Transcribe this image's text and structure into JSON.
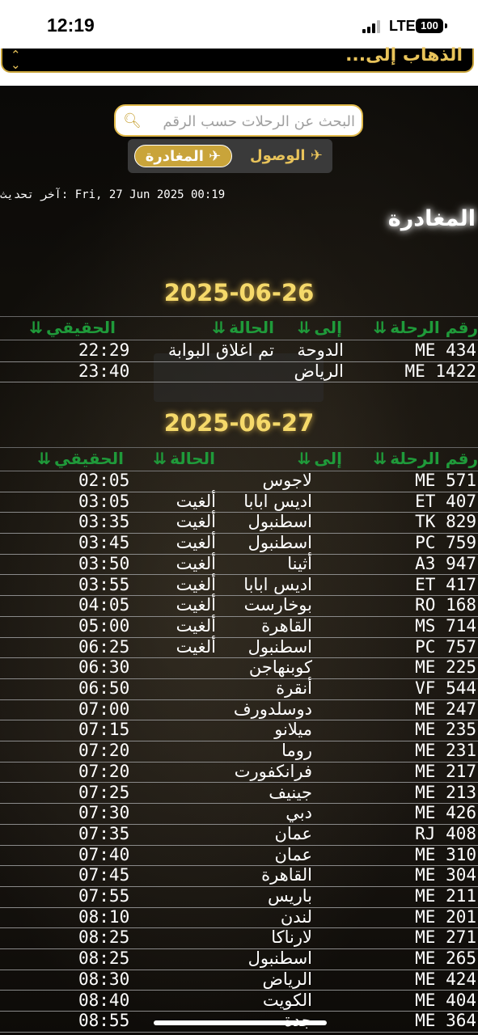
{
  "status_bar": {
    "time": "12:19",
    "network": "LTE",
    "battery": "100"
  },
  "destination_dropdown": {
    "label": "الذهاب إلى..."
  },
  "search": {
    "placeholder": "البحث عن الرحلات حسب الرقم"
  },
  "tabs": {
    "arrivals": "الوصول",
    "departures": "المغادرة",
    "active": "departures"
  },
  "last_updated": "آخر تحديث: Fri, 27 Jun 2025 00:19",
  "section_title": "المغادرة",
  "columns": {
    "flight": "رقم الرحلة",
    "to": "إلى",
    "status": "الحالة",
    "actual": "الحقيقي"
  },
  "groups": [
    {
      "date": "2025-06-26",
      "rows": [
        {
          "flight": "ME 434",
          "to": "الدوحة",
          "status": "تم اغلاق البوابة",
          "actual": "22:29"
        },
        {
          "flight": "ME 1422",
          "to": "الرياض",
          "status": "",
          "actual": "23:40"
        }
      ]
    },
    {
      "date": "2025-06-27",
      "rows": [
        {
          "flight": "ME 571",
          "to": "لاجوس",
          "status": "",
          "actual": "02:05"
        },
        {
          "flight": "ET 407",
          "to": "اديس ابابا",
          "status": "ألغيت",
          "actual": "03:05"
        },
        {
          "flight": "TK 829",
          "to": "اسطنبول",
          "status": "ألغيت",
          "actual": "03:35"
        },
        {
          "flight": "PC 759",
          "to": "اسطنبول",
          "status": "ألغيت",
          "actual": "03:45"
        },
        {
          "flight": "A3 947",
          "to": "أثينا",
          "status": "ألغيت",
          "actual": "03:50"
        },
        {
          "flight": "ET 417",
          "to": "اديس ابابا",
          "status": "ألغيت",
          "actual": "03:55"
        },
        {
          "flight": "RO 168",
          "to": "بوخارست",
          "status": "ألغيت",
          "actual": "04:05"
        },
        {
          "flight": "MS 714",
          "to": "القاهرة",
          "status": "ألغيت",
          "actual": "05:00"
        },
        {
          "flight": "PC 757",
          "to": "اسطنبول",
          "status": "ألغيت",
          "actual": "06:25"
        },
        {
          "flight": "ME 225",
          "to": "كوبنهاجن",
          "status": "",
          "actual": "06:30"
        },
        {
          "flight": "VF 544",
          "to": "أنقرة",
          "status": "",
          "actual": "06:50"
        },
        {
          "flight": "ME 247",
          "to": "دوسلدورف",
          "status": "",
          "actual": "07:00"
        },
        {
          "flight": "ME 235",
          "to": "ميلانو",
          "status": "",
          "actual": "07:15"
        },
        {
          "flight": "ME 231",
          "to": "روما",
          "status": "",
          "actual": "07:20"
        },
        {
          "flight": "ME 217",
          "to": "فرانكفورت",
          "status": "",
          "actual": "07:20"
        },
        {
          "flight": "ME 213",
          "to": "جينيف",
          "status": "",
          "actual": "07:25"
        },
        {
          "flight": "ME 426",
          "to": "دبي",
          "status": "",
          "actual": "07:30"
        },
        {
          "flight": "RJ 408",
          "to": "عمان",
          "status": "",
          "actual": "07:35"
        },
        {
          "flight": "ME 310",
          "to": "عمان",
          "status": "",
          "actual": "07:40"
        },
        {
          "flight": "ME 304",
          "to": "القاهرة",
          "status": "",
          "actual": "07:45"
        },
        {
          "flight": "ME 211",
          "to": "باريس",
          "status": "",
          "actual": "07:55"
        },
        {
          "flight": "ME 201",
          "to": "لندن",
          "status": "",
          "actual": "08:10"
        },
        {
          "flight": "ME 271",
          "to": "لارناكا",
          "status": "",
          "actual": "08:25"
        },
        {
          "flight": "ME 265",
          "to": "اسطنبول",
          "status": "",
          "actual": "08:25"
        },
        {
          "flight": "ME 424",
          "to": "الرياض",
          "status": "",
          "actual": "08:30"
        },
        {
          "flight": "ME 404",
          "to": "الكويت",
          "status": "",
          "actual": "08:40"
        },
        {
          "flight": "ME 364",
          "to": "جدة",
          "status": "",
          "actual": "08:55"
        }
      ]
    }
  ]
}
